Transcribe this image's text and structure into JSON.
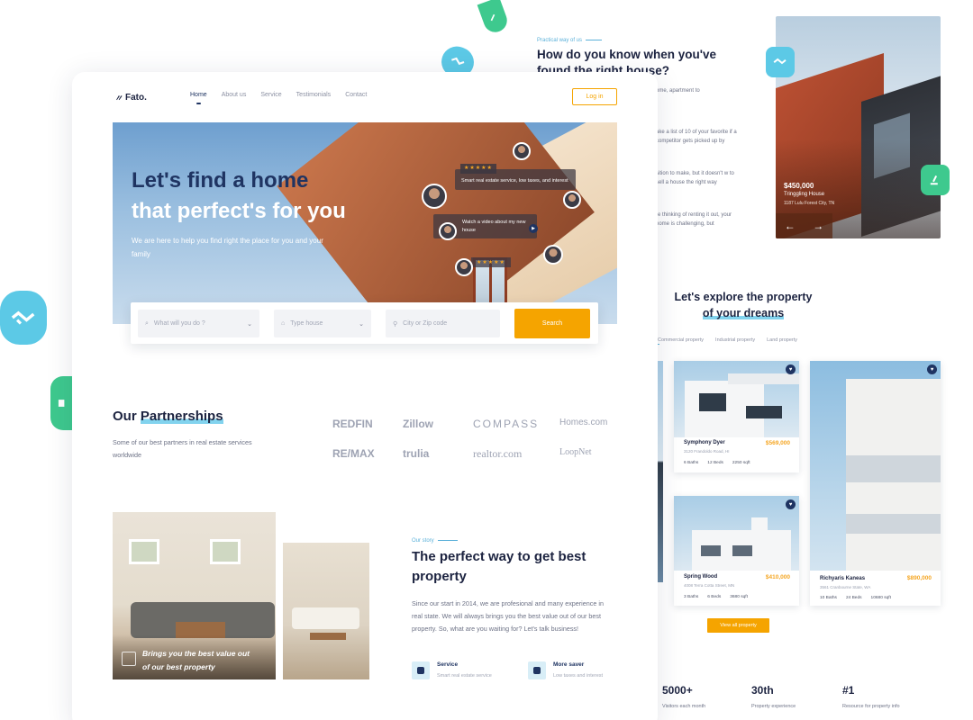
{
  "back": {
    "eyebrow": "Practical way of us",
    "heading": "How do you know when you've found the right house?",
    "snippets": [
      "ome, apartment to",
      "ake a list of 10 of your favorite if a competitor gets picked up by",
      "sition to make, but it doesn't w to sell a house the right way",
      "re thinking of renting it out, your home is challenging, but"
    ],
    "featured": {
      "price": "$450,000",
      "name": "Tringgling House",
      "address": "1187 Lulu Forest City, TN"
    },
    "explore": {
      "line1": "Let's explore the property",
      "line2": "of your dreams"
    },
    "tabs": [
      "Commercial property",
      "Industrial property",
      "Land property"
    ],
    "properties": [
      {
        "name": "Symphony Dyer",
        "price": "$569,000",
        "address": "3120 Frandoldo Road, HI",
        "baths": "6 Baths",
        "beds": "12 Beds",
        "size": "2250 sqft"
      },
      {
        "name": "Spring Wood",
        "price": "$410,000",
        "address": "4008 Terra Cotta Street, MN",
        "baths": "3 Baths",
        "beds": "6 Beds",
        "size": "3680 sqft"
      },
      {
        "name": "Richyaris Kaneas",
        "price": "$890,000",
        "address": "3561 Cranbourne State, WA",
        "baths": "10 Baths",
        "beds": "24 Beds",
        "size": "10680 sqft"
      }
    ],
    "view_all": "View all property",
    "stats": [
      {
        "num": "5000+",
        "label": "Visitors each month"
      },
      {
        "num": "30th",
        "label": "Property experience"
      },
      {
        "num": "#1",
        "label": "Resource for property info"
      }
    ]
  },
  "front": {
    "logo": "Fato.",
    "nav": [
      "Home",
      "About us",
      "Service",
      "Testimonials",
      "Contact"
    ],
    "login": "Log in",
    "hero": {
      "title1": "Let's find a home",
      "title2": "that perfect's for you",
      "subtitle": "We are here to help you find right the place for you and your family",
      "bubble1": "Smart real estate service, low taxes, and interest",
      "bubble2": "Watch a video about my new house",
      "stars": "★★★★★"
    },
    "search": {
      "what_placeholder": "What will you do ?",
      "type_placeholder": "Type house",
      "city_placeholder": "City or Zip code",
      "button": "Search"
    },
    "partners": {
      "title_a": "Our ",
      "title_b": "Partnerships",
      "subtitle": "Some of our best partners in real estate services worldwide",
      "logos": [
        "REDFIN",
        "Zillow",
        "COMPASS",
        "Homes.com",
        "RE/MAX",
        "trulia",
        "realtor.com",
        "LoopNet"
      ]
    },
    "story": {
      "eyebrow": "Our story",
      "title": "The perfect way to get best property",
      "body": "Since our start in 2014, we are profesional and many experience in real state. We will always brings you the best value out of our best property. So, what are you waiting for? Let's talk business!",
      "caption": "Brings you the best value out of our best property",
      "features": [
        {
          "title": "Service",
          "sub": "Smart real estate service"
        },
        {
          "title": "More saver",
          "sub": "Low taxes and interest"
        }
      ]
    }
  }
}
